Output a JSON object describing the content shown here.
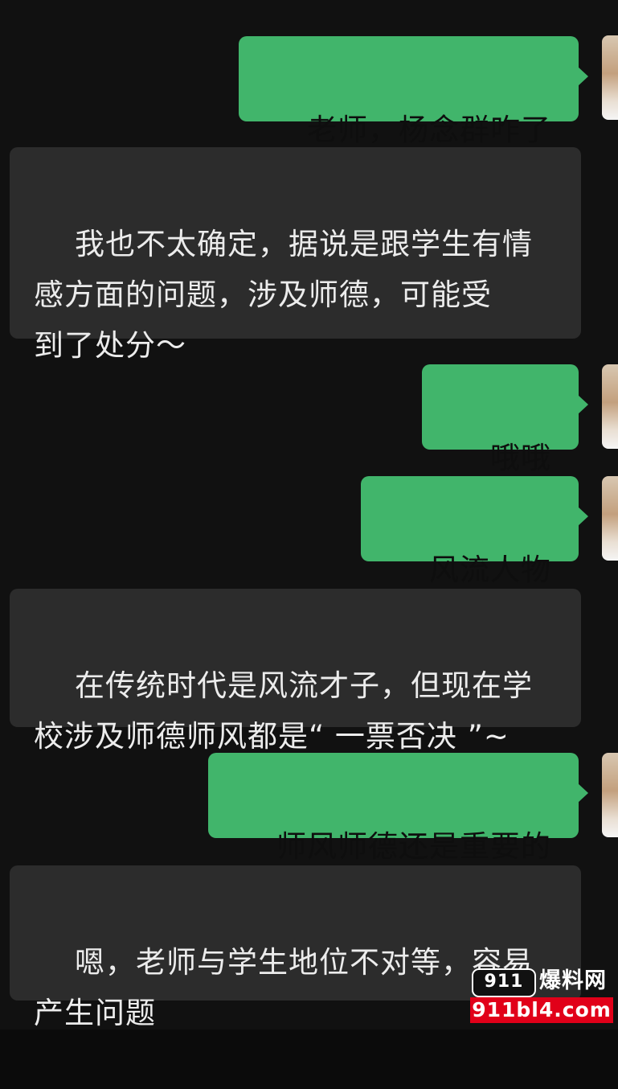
{
  "messages": [
    {
      "side": "sent",
      "text": "老师，杨念群咋了"
    },
    {
      "side": "received",
      "text": "我也不太确定，据说是跟学生有情\n感方面的问题，涉及师德，可能受\n到了处分～"
    },
    {
      "side": "sent",
      "text": "哦哦"
    },
    {
      "side": "sent",
      "text": "风流人物"
    },
    {
      "side": "received",
      "text": "在传统时代是风流才子，但现在学\n校涉及师德师风都是“ 一票否决 ”~"
    },
    {
      "side": "sent",
      "text": "师风师德还是重要的"
    },
    {
      "side": "received",
      "text": "嗯，老师与学生地位不对等，容易\n产生问题"
    }
  ],
  "watermark": {
    "badge": "911",
    "name": "爆料网",
    "domain": "911bl4.com"
  },
  "colors": {
    "background": "#111111",
    "received_bubble": "#2c2c2c",
    "sent_bubble": "#41b56b",
    "watermark_red": "#e10019"
  }
}
